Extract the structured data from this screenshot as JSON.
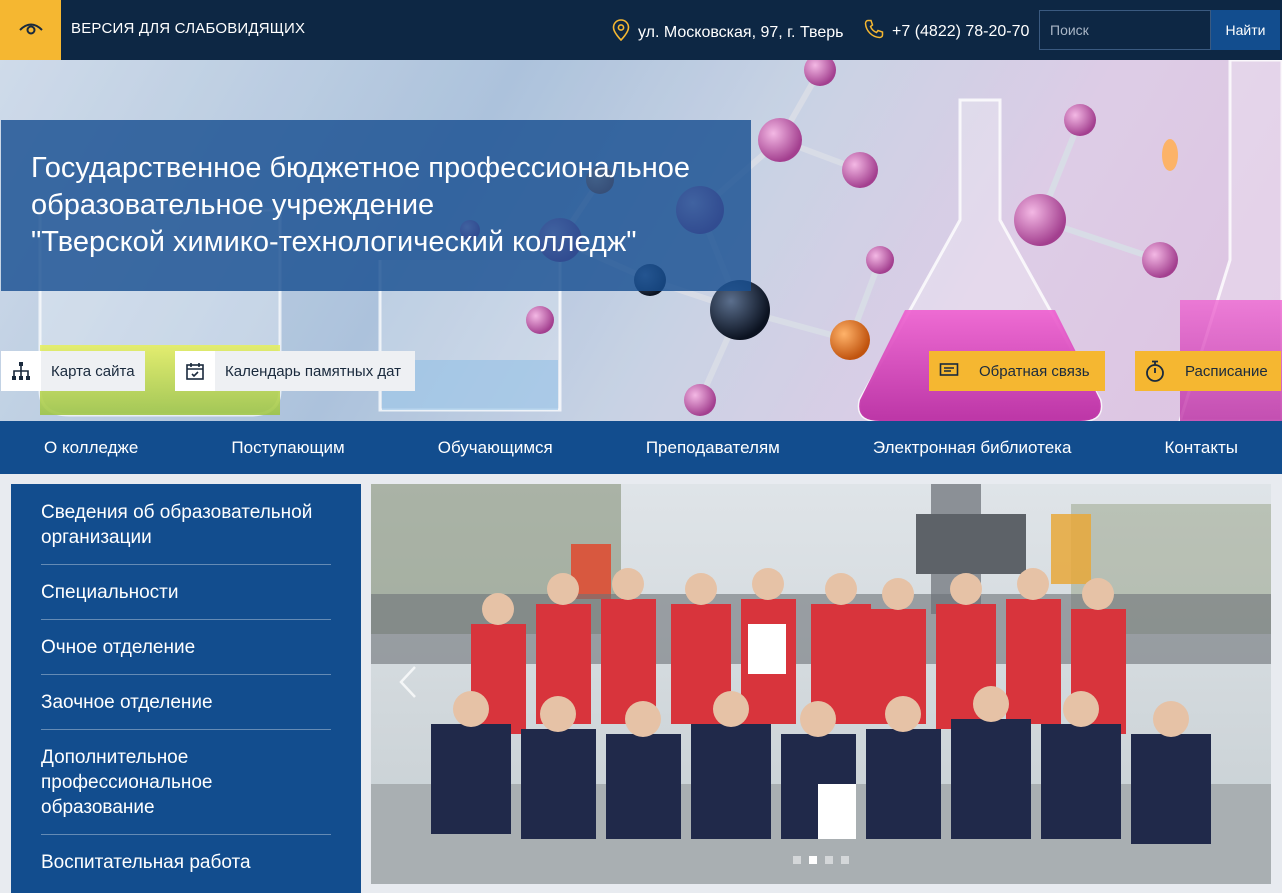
{
  "topbar": {
    "vision_label": "ВЕРСИЯ ДЛЯ СЛАБОВИДЯЩИХ",
    "address": "ул. Московская, 97, г. Тверь",
    "phone": "+7 (4822) 78-20-70",
    "search_placeholder": "Поиск",
    "search_button": "Найти"
  },
  "hero": {
    "title": "Государственное бюджетное профессиональное\nобразовательное учреждение\n\"Тверской химико-технологический колледж\"",
    "quick_links": {
      "sitemap": "Карта сайта",
      "calendar": "Календарь памятных дат",
      "feedback": "Обратная связь",
      "schedule": "Расписание"
    }
  },
  "nav": {
    "items": [
      "О колледже",
      "Поступающим",
      "Обучающимся",
      "Преподавателям",
      "Электронная библиотека",
      "Контакты"
    ]
  },
  "sidebar": {
    "items": [
      "Сведения об образовательной организации",
      "Специальности",
      "Очное отделение",
      "Заочное отделение",
      "Дополнительное профессиональное образование",
      "Воспитательная работа"
    ]
  },
  "slider": {
    "dots": 4,
    "active_dot": 1
  },
  "colors": {
    "topbar": "#0d2744",
    "accent_yellow": "#f5b731",
    "nav_blue": "#124d8e"
  },
  "icons": [
    "eye-icon",
    "map-pin-icon",
    "phone-icon",
    "sitemap-icon",
    "calendar-icon",
    "message-icon",
    "stopwatch-icon",
    "chevron-left-icon"
  ]
}
